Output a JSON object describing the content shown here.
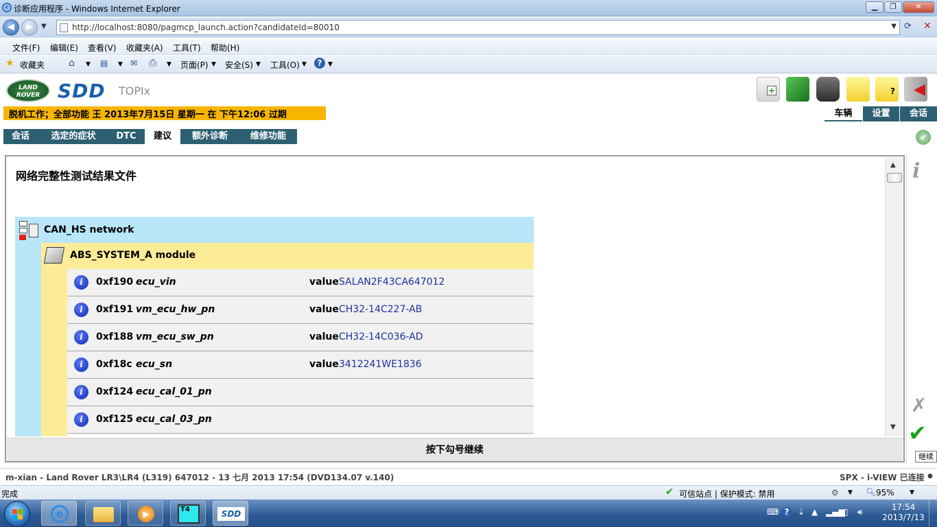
{
  "window": {
    "title": "诊断应用程序 - Windows Internet Explorer",
    "min": "▁",
    "max": "❐",
    "close": "✕"
  },
  "address": {
    "url": "http://localhost:8080/pagmcp_launch.action?candidateId=80010"
  },
  "menu": [
    "文件(F)",
    "编辑(E)",
    "查看(V)",
    "收藏夹(A)",
    "工具(T)",
    "帮助(H)"
  ],
  "commandbar": {
    "favorites": "收藏夹",
    "page": "页面(P)",
    "safety": "安全(S)",
    "tools": "工具(O)"
  },
  "sdd": {
    "brand_lr": "LAND ROVER",
    "logo": "SDD",
    "product": "TOPIx",
    "offline_notice": "脱机工作；全部功能 王 2013年7月15日 星期一 在 下午12:06 过期",
    "right_tabs": [
      "车辆",
      "设置",
      "会话"
    ],
    "tabs": [
      "会话",
      "选定的症状",
      "DTC",
      "建议",
      "额外诊断",
      "维修功能"
    ],
    "active_tab": "建议"
  },
  "content": {
    "title": "网络完整性测试结果文件",
    "network": "CAN_HS network",
    "module": "ABS_SYSTEM_A module",
    "value_label": "value",
    "dids": [
      {
        "code": "0xf190",
        "name": "ecu_vin",
        "value": "SALAN2F43CA647012"
      },
      {
        "code": "0xf191",
        "name": "vm_ecu_hw_pn",
        "value": "CH32-14C227-AB"
      },
      {
        "code": "0xf188",
        "name": "vm_ecu_sw_pn",
        "value": "CH32-14C036-AD"
      },
      {
        "code": "0xf18c",
        "name": "ecu_sn",
        "value": "3412241WE1836"
      },
      {
        "code": "0xf124",
        "name": "ecu_cal_01_pn",
        "value": ""
      },
      {
        "code": "0xf125",
        "name": "ecu_cal_03_pn",
        "value": ""
      }
    ]
  },
  "footer": {
    "continue_text": "按下勾号继续",
    "tooltip": "继续",
    "status_left": "m-xian - Land Rover LR3\\LR4 (L319) 647012 - 13 七月 2013 17:54 (DVD134.07 v.140)",
    "status_right": "SPX - i-VIEW 已连接"
  },
  "ie_status": {
    "left": "完成",
    "zone": "可信站点 | 保护模式: 禁用",
    "zoom": "95%"
  },
  "taskbar": {
    "sdd_label": "SDD",
    "time": "17:54",
    "date": "2013/7/13"
  },
  "colors": {
    "accent": "#2d5f72",
    "offline": "#f7b500",
    "network_bg": "#b9e6f8",
    "module_bg": "#fcec98"
  }
}
